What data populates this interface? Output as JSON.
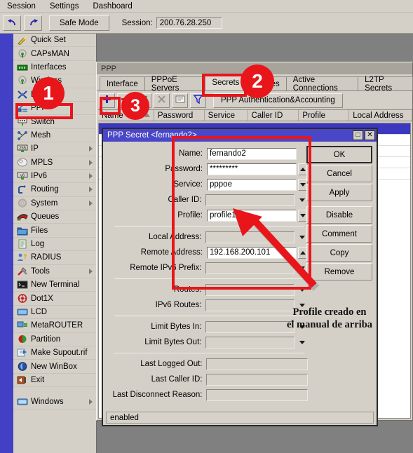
{
  "menubar": {
    "items": [
      "Session",
      "Settings",
      "Dashboard"
    ]
  },
  "toolbar": {
    "undo_icon": "undo-icon",
    "redo_icon": "redo-icon",
    "safe_mode_label": "Safe Mode",
    "session_label": "Session:",
    "session_value": "200.76.28.250"
  },
  "sidebar": {
    "items": [
      {
        "label": "Quick Set",
        "icon": "wand-icon",
        "submenu": false
      },
      {
        "label": "CAPsMAN",
        "icon": "antenna-icon",
        "submenu": false
      },
      {
        "label": "Interfaces",
        "icon": "interfaces-icon",
        "submenu": false
      },
      {
        "label": "Wireless",
        "icon": "antenna-icon",
        "submenu": false
      },
      {
        "label": "Bridge",
        "icon": "bridge-icon",
        "submenu": false
      },
      {
        "label": "PPP",
        "icon": "ppp-icon",
        "submenu": false
      },
      {
        "label": "Switch",
        "icon": "switch-icon",
        "submenu": false
      },
      {
        "label": "Mesh",
        "icon": "mesh-icon",
        "submenu": false
      },
      {
        "label": "IP",
        "icon": "ip-icon",
        "submenu": true
      },
      {
        "label": "MPLS",
        "icon": "mpls-icon",
        "submenu": true
      },
      {
        "label": "IPv6",
        "icon": "ipv6-icon",
        "submenu": true
      },
      {
        "label": "Routing",
        "icon": "routing-icon",
        "submenu": true
      },
      {
        "label": "System",
        "icon": "system-icon",
        "submenu": true
      },
      {
        "label": "Queues",
        "icon": "queues-icon",
        "submenu": false
      },
      {
        "label": "Files",
        "icon": "folder-icon",
        "submenu": false
      },
      {
        "label": "Log",
        "icon": "log-icon",
        "submenu": false
      },
      {
        "label": "RADIUS",
        "icon": "radius-icon",
        "submenu": false
      },
      {
        "label": "Tools",
        "icon": "tools-icon",
        "submenu": true
      },
      {
        "label": "New Terminal",
        "icon": "terminal-icon",
        "submenu": false
      },
      {
        "label": "Dot1X",
        "icon": "dot1x-icon",
        "submenu": false
      },
      {
        "label": "LCD",
        "icon": "lcd-icon",
        "submenu": false
      },
      {
        "label": "MetaROUTER",
        "icon": "metarouter-icon",
        "submenu": false
      },
      {
        "label": "Partition",
        "icon": "partition-icon",
        "submenu": false
      },
      {
        "label": "Make Supout.rif",
        "icon": "supout-icon",
        "submenu": false
      },
      {
        "label": "New WinBox",
        "icon": "winbox-icon",
        "submenu": false
      },
      {
        "label": "Exit",
        "icon": "exit-icon",
        "submenu": false
      }
    ],
    "footer": {
      "label": "Windows",
      "icon": "windows-icon",
      "submenu": true
    }
  },
  "ppp_window": {
    "title": "PPP",
    "tabs": [
      {
        "label": "Interface",
        "active": false
      },
      {
        "label": "PPPoE Servers",
        "active": false
      },
      {
        "label": "Secrets",
        "active": true
      },
      {
        "label": "Profiles",
        "active": false
      },
      {
        "label": "Active Connections",
        "active": false
      },
      {
        "label": "L2TP Secrets",
        "active": false
      }
    ],
    "toolbar": {
      "add_icon": "plus-icon",
      "remove_icon": "minus-icon",
      "enable_icon": "check-icon",
      "disable_icon": "cross-icon",
      "comment_icon": "comment-icon",
      "filter_icon": "filter-icon",
      "auth_button_label": "PPP Authentication&Accounting"
    },
    "columns": [
      "Name",
      "Password",
      "Service",
      "Caller ID",
      "Profile",
      "Local Address"
    ]
  },
  "dialog": {
    "title": "PPP Secret <fernando2>",
    "restore_glyph": "□",
    "close_glyph": "✕",
    "fields": [
      {
        "label": "Name:",
        "value": "fernando2",
        "control": "text",
        "filled": true
      },
      {
        "label": "Password:",
        "value": "*********",
        "control": "spin-up",
        "filled": true
      },
      {
        "label": "Service:",
        "value": "pppoe",
        "control": "spin-down",
        "filled": true
      },
      {
        "label": "Caller ID:",
        "value": "",
        "control": "caret",
        "filled": false
      },
      {
        "label": "Profile:",
        "value": "profile1",
        "control": "spin-down",
        "filled": true
      },
      {
        "label": "Local Address:",
        "value": "",
        "control": "caret",
        "filled": false
      },
      {
        "label": "Remote Address:",
        "value": "192.168.200.101",
        "control": "spin-up",
        "filled": true
      },
      {
        "label": "Remote IPv6 Prefix:",
        "value": "",
        "control": "caret",
        "filled": false
      },
      {
        "label": "Routes:",
        "value": "",
        "control": "caret",
        "filled": false
      },
      {
        "label": "IPv6 Routes:",
        "value": "",
        "control": "caret",
        "filled": false
      },
      {
        "label": "Limit Bytes In:",
        "value": "",
        "control": "caret",
        "filled": false
      },
      {
        "label": "Limit Bytes Out:",
        "value": "",
        "control": "caret",
        "filled": false
      },
      {
        "label": "Last Logged Out:",
        "value": "",
        "control": "none",
        "filled": false
      },
      {
        "label": "Last Caller ID:",
        "value": "",
        "control": "none",
        "filled": false
      },
      {
        "label": "Last Disconnect Reason:",
        "value": "",
        "control": "none",
        "filled": false
      }
    ],
    "buttons": [
      "OK",
      "Cancel",
      "Apply",
      "Disable",
      "Comment",
      "Copy",
      "Remove"
    ],
    "status": "enabled"
  },
  "annotations": {
    "badges": [
      "1",
      "2",
      "3"
    ],
    "note": "Profile creado en\nel manual de arriba",
    "accent_color": "#e8151b"
  }
}
